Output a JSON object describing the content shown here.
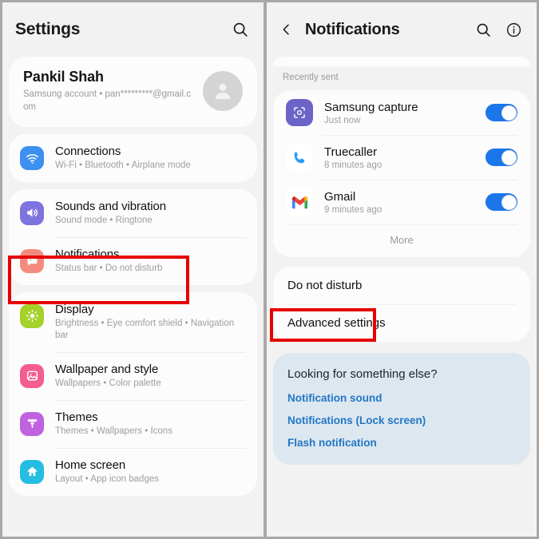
{
  "left_panel": {
    "header": {
      "title": "Settings",
      "search_icon": "search-icon"
    },
    "account": {
      "name": "Pankil Shah",
      "subtitle": "Samsung account  •  pan*********@gmail.com",
      "avatar_icon": "person-avatar-icon"
    },
    "items": [
      {
        "title": "Connections",
        "subtitle": "Wi-Fi  •  Bluetooth  •  Airplane mode",
        "icon": "wifi-icon",
        "color": "#3d8ff0"
      },
      {
        "title": "Sounds and vibration",
        "subtitle": "Sound mode  •  Ringtone",
        "icon": "speaker-icon",
        "color": "#7d74e0"
      },
      {
        "title": "Notifications",
        "subtitle": "Status bar  •  Do not disturb",
        "icon": "notification-icon",
        "color": "#f48b7e"
      },
      {
        "title": "Display",
        "subtitle": "Brightness  •  Eye comfort shield  •  Navigation bar",
        "icon": "brightness-icon",
        "color": "#a4d12a"
      },
      {
        "title": "Wallpaper and style",
        "subtitle": "Wallpapers  •  Color palette",
        "icon": "image-icon",
        "color": "#f45d8e"
      },
      {
        "title": "Themes",
        "subtitle": "Themes  •  Wallpapers  •  Icons",
        "icon": "brush-icon",
        "color": "#c062e0"
      },
      {
        "title": "Home screen",
        "subtitle": "Layout  •  App icon badges",
        "icon": "home-icon",
        "color": "#26bde2"
      }
    ]
  },
  "right_panel": {
    "header": {
      "title": "Notifications",
      "back_icon": "back-chevron-icon",
      "search_icon": "search-icon",
      "info_icon": "info-icon"
    },
    "recently_sent_label": "Recently sent",
    "notifications": [
      {
        "app": "Samsung capture",
        "time": "Just now",
        "icon": "samsung-capture-icon",
        "toggle_on": true
      },
      {
        "app": "Truecaller",
        "time": "8 minutes ago",
        "icon": "truecaller-phone-icon",
        "toggle_on": true
      },
      {
        "app": "Gmail",
        "time": "9 minutes ago",
        "icon": "gmail-icon",
        "toggle_on": true
      }
    ],
    "more_label": "More",
    "settings_rows": [
      {
        "label": "Do not disturb"
      },
      {
        "label": "Advanced settings"
      }
    ],
    "info_card": {
      "title": "Looking for something else?",
      "links": [
        "Notification sound",
        "Notifications (Lock screen)",
        "Flash notification"
      ],
      "background": "#dde7f0",
      "link_color": "#2277c5"
    }
  },
  "annotations": {
    "highlight_color": "#e60000",
    "boxes": [
      {
        "target": "Notifications",
        "panel": "left"
      },
      {
        "target": "Do not disturb",
        "panel": "right"
      }
    ]
  }
}
